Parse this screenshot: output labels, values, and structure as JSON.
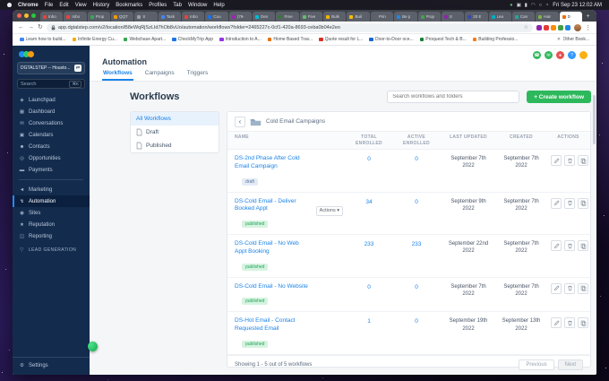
{
  "menubar": {
    "items": [
      "Chrome",
      "File",
      "Edit",
      "View",
      "History",
      "Bookmarks",
      "Profiles",
      "Tab",
      "Window",
      "Help"
    ],
    "status_icons": [
      {
        "name": "meet-camera-icon",
        "glyph": "●",
        "color": "#58c472"
      },
      {
        "name": "display-icon",
        "glyph": "▣",
        "color": "#d9d9de"
      },
      {
        "name": "battery-icon",
        "glyph": "▮",
        "color": "#d9d9de"
      },
      {
        "name": "wifi-icon",
        "glyph": "◠",
        "color": "#d9d9de"
      },
      {
        "name": "spotlight-icon",
        "glyph": "○",
        "color": "#d9d9de"
      },
      {
        "name": "control-center-icon",
        "glyph": "◔",
        "color": "#d9d9de"
      }
    ],
    "clock": "Fri Sep 23 12:02 AM"
  },
  "browser": {
    "tabs": [
      {
        "label": "Inbo",
        "color": "#ea4335"
      },
      {
        "label": "Inbo",
        "color": "#ea4335"
      },
      {
        "label": "Prop",
        "color": "#34a853"
      },
      {
        "label": "QQT",
        "color": "#f29900"
      },
      {
        "label": "S",
        "color": "#9aa0a6"
      },
      {
        "label": "Task",
        "color": "#4285f4"
      },
      {
        "label": "Inbo",
        "color": "#ea4335"
      },
      {
        "label": "Cou",
        "color": "#1a73e8"
      },
      {
        "label": "(79-",
        "color": "#9c27b0"
      },
      {
        "label": "Des",
        "color": "#00bcd4"
      },
      {
        "label": "Free",
        "color": "#2e7d32"
      },
      {
        "label": "Five",
        "color": "#66bb6a"
      },
      {
        "label": "Bulk",
        "color": "#f4b400"
      },
      {
        "label": "Buil",
        "color": "#fbbc04"
      },
      {
        "label": "Prin",
        "color": "#5f6368"
      },
      {
        "label": "Be p",
        "color": "#1e88e5"
      },
      {
        "label": "Prop",
        "color": "#43a047"
      },
      {
        "label": "S",
        "color": "#8e24aa"
      },
      {
        "label": "20 E",
        "color": "#3949ab"
      },
      {
        "label": "Lea",
        "color": "#00acc1"
      },
      {
        "label": "Can",
        "color": "#26a69a"
      },
      {
        "label": "Han",
        "color": "#7cb342"
      },
      {
        "label": "D",
        "color": "#ef6c00",
        "active": true
      }
    ],
    "new_tab_glyph": "+",
    "nav": {
      "back": "←",
      "forward": "→",
      "reload": "↻"
    },
    "url": "app.dgtalstep.com/v2/location/B8eWqRjSzLId7hOb8vUo/automation/workflows?folder=2465227c-0cf1-420a-8693-ceba0b04e2eo",
    "star_glyph": "☆",
    "menu_glyph": "⋮",
    "extensions": [
      "#8e24aa",
      "#e53935",
      "#fb8c00",
      "#43a047",
      "#1e88e5"
    ],
    "bookmarks": [
      {
        "label": "Learn how to build...",
        "color": "#4285f4"
      },
      {
        "label": "Infinite Energy Cu...",
        "color": "#f9ab00"
      },
      {
        "label": "Webchase Apart...",
        "color": "#34a853"
      },
      {
        "label": "CheckMyTrip App",
        "color": "#1a73e8"
      },
      {
        "label": "Introduction to A...",
        "color": "#9334e6"
      },
      {
        "label": "Home Based Trav...",
        "color": "#e8710a"
      },
      {
        "label": "Quote result for L...",
        "color": "#d93025"
      },
      {
        "label": "Door-to-Door oce...",
        "color": "#1967d2"
      },
      {
        "label": "Proquest Tech & B...",
        "color": "#188038"
      },
      {
        "label": "Building Professio...",
        "color": "#fa7b17"
      }
    ],
    "bookmarks_overflow": "»",
    "other_bookmarks": "Other Book..."
  },
  "app": {
    "sidebar": {
      "account_name": "DGTALSTEP -- Housto...",
      "switcher_glyph": "⇄",
      "search_placeholder": "Search",
      "search_shortcut": "⌘K",
      "primary": [
        {
          "label": "Launchpad",
          "icon": "rocket-icon",
          "glyph": "◈"
        },
        {
          "label": "Dashboard",
          "icon": "dashboard-icon",
          "glyph": "▦"
        },
        {
          "label": "Conversations",
          "icon": "chat-icon",
          "glyph": "✉"
        },
        {
          "label": "Calendars",
          "icon": "calendar-icon",
          "glyph": "▣"
        },
        {
          "label": "Contacts",
          "icon": "contacts-icon",
          "glyph": "☻"
        },
        {
          "label": "Opportunities",
          "icon": "opportunities-icon",
          "glyph": "◎"
        },
        {
          "label": "Payments",
          "icon": "payments-icon",
          "glyph": "▬"
        }
      ],
      "secondary": [
        {
          "label": "Marketing",
          "icon": "marketing-icon",
          "glyph": "◄"
        },
        {
          "label": "Automation",
          "icon": "automation-icon",
          "glyph": "↯",
          "active": true
        },
        {
          "label": "Sites",
          "icon": "sites-icon",
          "glyph": "◉"
        },
        {
          "label": "Reputation",
          "icon": "reputation-icon",
          "glyph": "★"
        },
        {
          "label": "Reporting",
          "icon": "reporting-icon",
          "glyph": "◫"
        },
        {
          "label": "LEAD GENERATION",
          "icon": "lead-gen-icon",
          "glyph": "▽",
          "section": true
        }
      ],
      "settings": {
        "label": "Settings",
        "icon": "gear-icon",
        "glyph": "⚙"
      }
    },
    "header": {
      "title": "Automation",
      "tabs": [
        {
          "label": "Workflows",
          "active": true
        },
        {
          "label": "Campaigns"
        },
        {
          "label": "Triggers"
        }
      ],
      "top_icons": [
        {
          "name": "phone-icon",
          "bg": "#2eb85c",
          "glyph": "☎"
        },
        {
          "name": "message-icon",
          "bg": "#2eb85c",
          "glyph": "✉"
        },
        {
          "name": "notification-icon",
          "bg": "#e55353",
          "glyph": "●"
        },
        {
          "name": "help-icon",
          "bg": "#3399ff",
          "glyph": "?"
        },
        {
          "name": "avatar",
          "bg": "#f9b115",
          "glyph": ""
        }
      ]
    },
    "workflows": {
      "title": "Workflows",
      "search_placeholder": "Search workflows and folders",
      "create_label": "+ Create workflow",
      "folders": [
        {
          "label": "All Workflows",
          "active": true,
          "icon": false
        },
        {
          "label": "Draft",
          "icon": true
        },
        {
          "label": "Published",
          "icon": true
        }
      ],
      "back_glyph": "‹",
      "breadcrumb_folder": "Cold Email Campaigns",
      "columns": [
        "NAME",
        "TOTAL ENROLLED",
        "ACTIVE ENROLLED",
        "LAST UPDATED",
        "CREATED",
        "ACTIONS"
      ],
      "dropdown_label": "Actions",
      "dropdown_caret": "▾",
      "rows": [
        {
          "name": "DS-2nd Phase After Cold Email Campaign",
          "status": "draft",
          "total_enrolled": "0",
          "active_enrolled": "0",
          "last_updated": "September 7th 2022",
          "created": "September 7th 2022"
        },
        {
          "name": "DS-Cold Email - Deliver Booked Appt",
          "status": "published",
          "has_actions_dropdown": true,
          "total_enrolled": "34",
          "active_enrolled": "0",
          "last_updated": "September 9th 2022",
          "created": "September 7th 2022"
        },
        {
          "name": "DS-Cold Email - No Web Appt Booking",
          "status": "published",
          "total_enrolled": "233",
          "active_enrolled": "233",
          "last_updated": "September 22nd 2022",
          "created": "September 7th 2022"
        },
        {
          "name": "DS-Cold Email - No Website",
          "status": "published",
          "total_enrolled": "0",
          "active_enrolled": "0",
          "last_updated": "September 7th 2022",
          "created": "September 7th 2022"
        },
        {
          "name": "DS-Hot Email - Contact Requested Email",
          "status": "published",
          "total_enrolled": "1",
          "active_enrolled": "0",
          "last_updated": "September 19th 2022",
          "created": "September 13th 2022"
        }
      ],
      "footer_text": "Showing 1 - 5 out of 5 workflows",
      "pagination": {
        "prev": "Previous",
        "next": "Next"
      }
    }
  }
}
